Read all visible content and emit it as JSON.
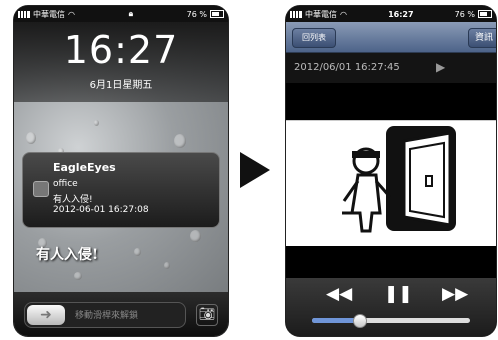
{
  "lock": {
    "carrier": "中華電信",
    "battery": "76 %",
    "time": "16:27",
    "date": "6月1日星期五",
    "notification": {
      "app": "EagleEyes",
      "line1": "office",
      "line2": "有人入侵!",
      "line3": "2012-06-01 16:27:08"
    },
    "overlay_text": "有人入侵!",
    "slider_text": "移動滑桿來解鎖",
    "icons": {
      "unlock_knob": "arrow-right-icon",
      "camera": "camera-icon"
    }
  },
  "player": {
    "carrier": "中華電信",
    "time": "16:27",
    "battery": "76 %",
    "back_label": "回列表",
    "right_label": "資訊",
    "timestamp": "2012/06/01 16:27:45",
    "progress_fraction": 0.3,
    "icons": {
      "play": "play-icon",
      "rewind": "rewind-icon",
      "pause": "pause-icon",
      "forward": "forward-icon"
    }
  },
  "colors": {
    "navbar": "#4d6389",
    "progress": "#6f95d8"
  }
}
